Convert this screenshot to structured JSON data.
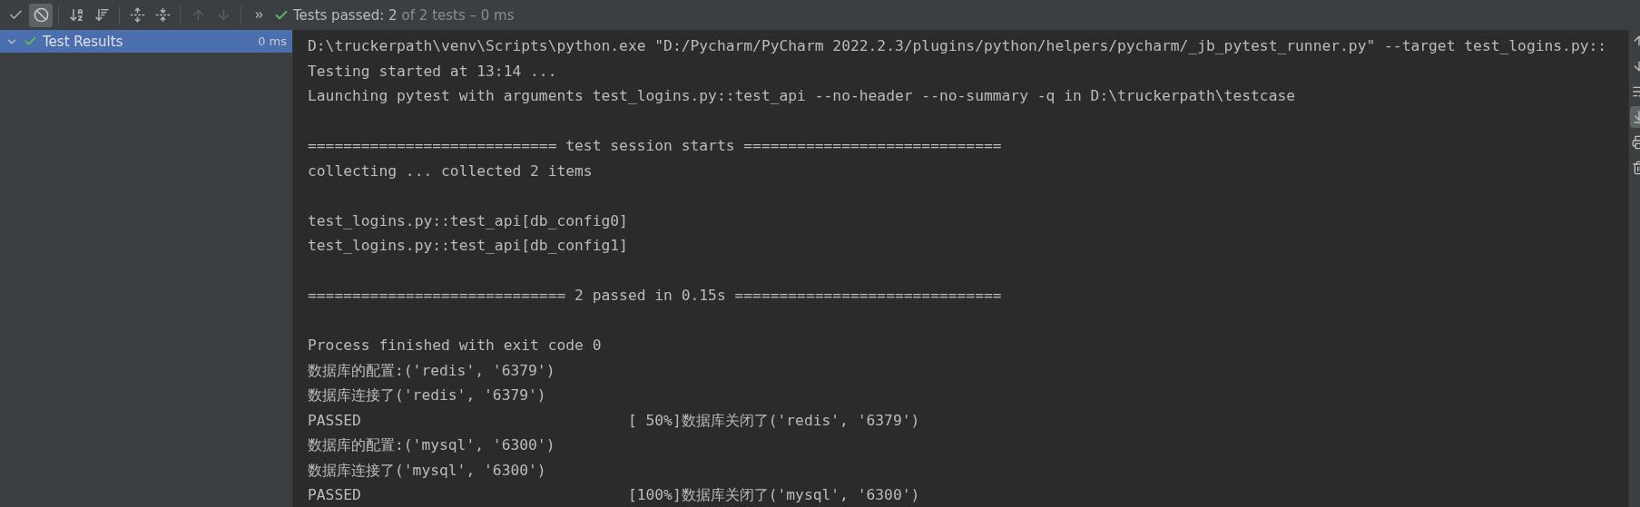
{
  "toolbar": {
    "buttons": [
      {
        "kind": "show-passed",
        "selected": false,
        "disabled": false
      },
      {
        "kind": "show-ignored",
        "selected": true,
        "disabled": false
      },
      {
        "kind": "sort-alpha",
        "selected": false,
        "disabled": false
      },
      {
        "kind": "sort-duration",
        "selected": false,
        "disabled": false
      },
      {
        "kind": "expand-all",
        "selected": false,
        "disabled": false
      },
      {
        "kind": "collapse-all",
        "selected": false,
        "disabled": false
      },
      {
        "kind": "previous",
        "selected": false,
        "disabled": true
      },
      {
        "kind": "next",
        "selected": false,
        "disabled": true
      },
      {
        "kind": "more",
        "selected": false,
        "disabled": false
      }
    ],
    "status": {
      "passed": "Tests passed: 2",
      "detail": "of 2 tests – 0 ms"
    }
  },
  "tree": [
    {
      "label": "Test Results",
      "time": "0 ms",
      "expanded": true,
      "selected": true
    }
  ],
  "console": {
    "blocks": [
      [
        "D:\\truckerpath\\venv\\Scripts\\python.exe \"D:/Pycharm/PyCharm 2022.2.3/plugins/python/helpers/pycharm/_jb_pytest_runner.py\" --target test_logins.py::",
        "Testing started at 13:14 ...",
        "Launching pytest with arguments test_logins.py::test_api --no-header --no-summary -q in D:\\truckerpath\\testcase"
      ],
      [
        "============================ test session starts =============================",
        "collecting ... collected 2 items"
      ],
      [
        "test_logins.py::test_api[db_config0]",
        "test_logins.py::test_api[db_config1]"
      ],
      [
        "============================= 2 passed in 0.15s =============================="
      ],
      [
        "Process finished with exit code 0",
        "数据库的配置:('redis', '6379')",
        "数据库连接了('redis', '6379')",
        "PASSED                              [ 50%]数据库关闭了('redis', '6379')",
        "数据库的配置:('mysql', '6300')",
        "数据库连接了('mysql', '6300')",
        "PASSED                              [100%]数据库关闭了('mysql', '6300')"
      ]
    ]
  },
  "side_strip": [
    {
      "kind": "up",
      "selected": false
    },
    {
      "kind": "down",
      "selected": false
    },
    {
      "kind": "wrap",
      "selected": false
    },
    {
      "kind": "scroll-end",
      "selected": true
    },
    {
      "kind": "print",
      "selected": false
    },
    {
      "kind": "trash",
      "selected": false
    }
  ]
}
